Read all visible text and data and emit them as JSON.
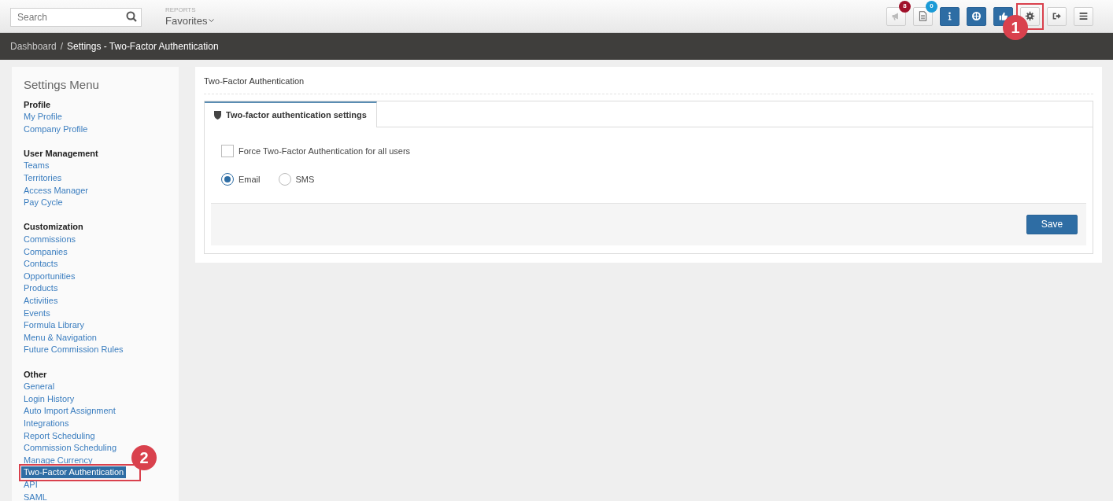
{
  "top_bar": {
    "search": {
      "placeholder": "Search"
    },
    "reports_label": "REPORTS",
    "favorites": "Favorites",
    "toolbar": [
      {
        "kind": "megaphone",
        "badge": "8",
        "color": "#a0102a",
        "primary": false
      },
      {
        "kind": "document",
        "badge": "0",
        "color": "#1a9ad6",
        "primary": false
      },
      {
        "kind": "info",
        "primary": true
      },
      {
        "kind": "lifebuoy",
        "primary": true
      },
      {
        "kind": "thumb",
        "primary": true
      },
      {
        "kind": "gear",
        "primary": false,
        "callout": "1"
      },
      {
        "kind": "signout",
        "primary": false
      },
      {
        "kind": "menu",
        "primary": false
      }
    ]
  },
  "breadcrumb": {
    "separator": "/",
    "items": [
      "Dashboard",
      "Settings - Two-Factor Authentication"
    ]
  },
  "sidebar": {
    "title": "Settings Menu",
    "sections": [
      {
        "heading": "Profile",
        "items": [
          {
            "label": "My Profile",
            "selected": false
          },
          {
            "label": "Company Profile",
            "selected": false
          }
        ]
      },
      {
        "heading": "User Management",
        "items": [
          {
            "label": "Teams",
            "selected": false
          },
          {
            "label": "Territories",
            "selected": false
          },
          {
            "label": "Access Manager",
            "selected": false
          },
          {
            "label": "Pay Cycle",
            "selected": false
          }
        ]
      },
      {
        "heading": "Customization",
        "items": [
          {
            "label": "Commissions",
            "selected": false
          },
          {
            "label": "Companies",
            "selected": false
          },
          {
            "label": "Contacts",
            "selected": false
          },
          {
            "label": "Opportunities",
            "selected": false
          },
          {
            "label": "Products",
            "selected": false
          },
          {
            "label": "Activities",
            "selected": false
          },
          {
            "label": "Events",
            "selected": false
          },
          {
            "label": "Formula Library",
            "selected": false
          },
          {
            "label": "Menu & Navigation",
            "selected": false
          },
          {
            "label": "Future Commission Rules",
            "selected": false
          }
        ]
      },
      {
        "heading": "Other",
        "items": [
          {
            "label": "General",
            "selected": false
          },
          {
            "label": "Login History",
            "selected": false
          },
          {
            "label": "Auto Import Assignment",
            "selected": false
          },
          {
            "label": "Integrations",
            "selected": false
          },
          {
            "label": "Report Scheduling",
            "selected": false
          },
          {
            "label": "Commission Scheduling",
            "selected": false
          },
          {
            "label": "Manage Currency",
            "selected": false
          },
          {
            "label": "Two-Factor Authentication",
            "selected": true,
            "callout": "2"
          },
          {
            "label": "API",
            "selected": false
          },
          {
            "label": "SAML",
            "selected": false
          }
        ]
      }
    ]
  },
  "main": {
    "title": "Two-Factor Authentication",
    "tabs": [
      {
        "label": "Two-factor authentication settings",
        "selected": true
      }
    ],
    "checkbox": {
      "label": "Force Two-Factor Authentication for all users",
      "checked": false
    },
    "radios": [
      {
        "label": "Email",
        "selected": true
      },
      {
        "label": "SMS",
        "selected": false
      }
    ],
    "save_button": "Save"
  }
}
